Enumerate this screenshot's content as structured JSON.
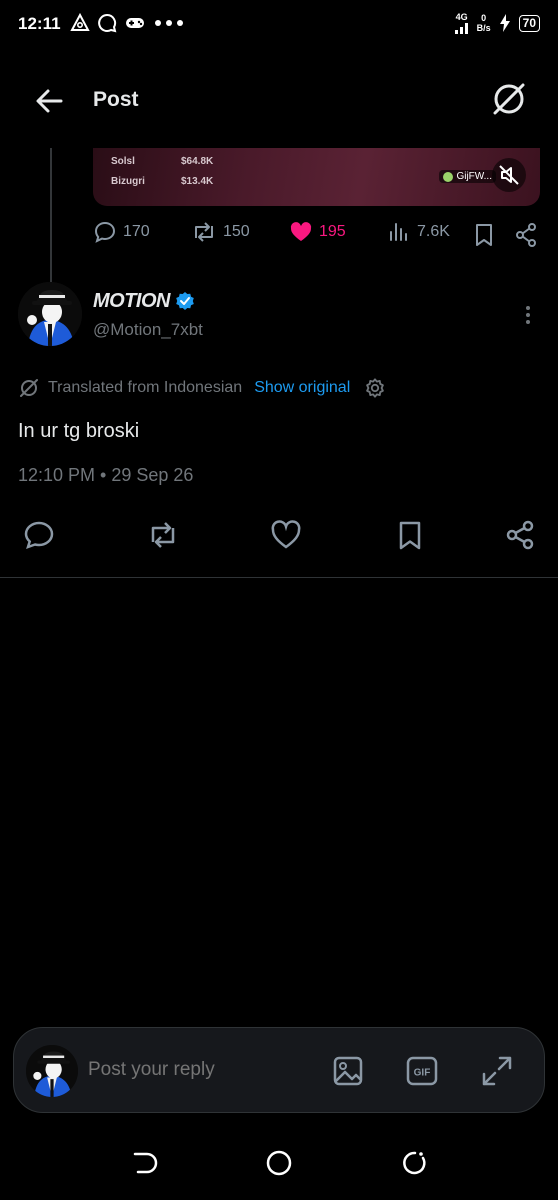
{
  "status_bar": {
    "time": "12:11",
    "net_type": "4G",
    "net_speed_value": "0",
    "net_speed_unit": "B/s",
    "battery": "70"
  },
  "header": {
    "title": "Post"
  },
  "parent_post": {
    "media_rows": [
      {
        "label": "Solsl",
        "value": "$64.8K"
      },
      {
        "label": "Bizugri",
        "value": "$13.4K"
      }
    ],
    "media_badge": "GijFW...",
    "stats": {
      "replies": "170",
      "reposts": "150",
      "likes": "195",
      "views": "7.6K"
    }
  },
  "post": {
    "author_name": "MOTION",
    "handle": "@Motion_7xbt",
    "translated_note": "Translated from Indonesian",
    "show_original": "Show original",
    "text": "In ur tg broski",
    "timestamp": "12:10 PM • 29 Sep 26"
  },
  "reply": {
    "placeholder": "Post your reply"
  },
  "colors": {
    "accent": "#1d9bf0",
    "like": "#f91880",
    "muted": "#71767b",
    "background": "#000000"
  }
}
